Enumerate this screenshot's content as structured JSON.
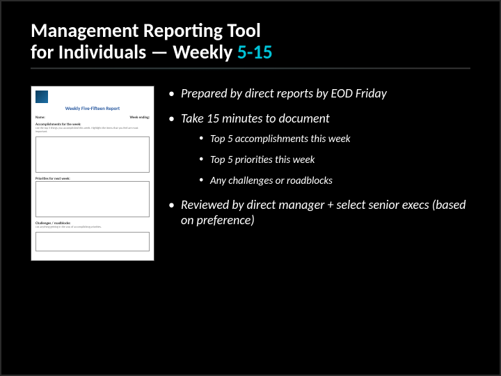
{
  "title_line1": "Management Reporting Tool",
  "title_line2_prefix": "for Individuals — Weekly ",
  "title_accent": "5-15",
  "bullets": [
    "Prepared by direct reports by EOD Friday",
    "Take 15 minutes to document",
    "Reviewed by direct manager + select senior execs (based on preference)"
  ],
  "sub_bullets": [
    "Top 5 accomplishments this week",
    "Top 5 priorities this week",
    "Any challenges or roadblocks"
  ],
  "thumbnail": {
    "report_title": "Weekly Five-Fifteen Report",
    "name_label": "Name:",
    "week_label": "Week ending:",
    "section1_label": "Accomplishments for the week:",
    "section1_hint": "List the top 5 things you accomplished this week. Highlight the items that you feel are most important.",
    "section2_label": "Priorities for next week:",
    "section3_label": "Challenges / roadblocks:",
    "section3_hint": "List anything getting in the way of accomplishing priorities."
  }
}
